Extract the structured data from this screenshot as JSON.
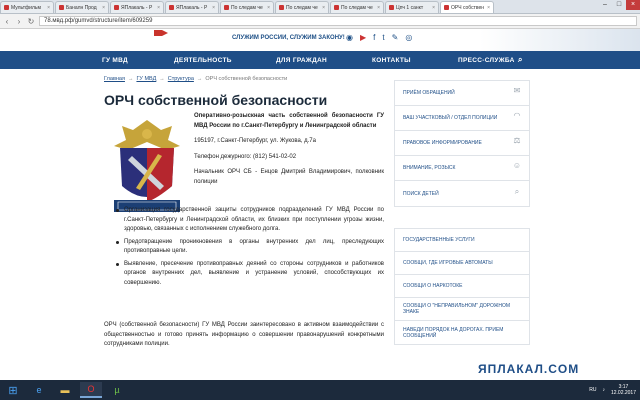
{
  "browser": {
    "tabs": [
      {
        "label": "Мультфильм"
      },
      {
        "label": "Баналн Прод"
      },
      {
        "label": "ЯПлакаль - Р"
      },
      {
        "label": "ЯПлакаль - Р"
      },
      {
        "label": "По следам че"
      },
      {
        "label": "По следам че"
      },
      {
        "label": "По следам че"
      },
      {
        "label": "Цпч 1 санкт"
      },
      {
        "label": "ОРЧ собствен"
      }
    ],
    "url": "78.мвд.рф/gumvd/structure/item/609259",
    "window_controls": {
      "minimize": "–",
      "maximize": "□",
      "close": "×"
    }
  },
  "site": {
    "slogan": "СЛУЖИМ РОССИИ, СЛУЖИМ ЗАКОНУ!",
    "social_icons": [
      "eye-icon",
      "youtube-icon",
      "facebook-icon",
      "twitter-icon",
      "vk-icon",
      "odnoklassniki-icon"
    ],
    "nav": [
      "ГУ МВД",
      "ДЕЯТЕЛЬНОСТЬ",
      "ДЛЯ ГРАЖДАН",
      "КОНТАКТЫ",
      "ПРЕСС-СЛУЖБА"
    ]
  },
  "breadcrumb": {
    "items": [
      "Главная",
      "ГУ МВД",
      "Структура"
    ],
    "current": "ОРЧ собственной безопасности",
    "sep": "→"
  },
  "page_title": "ОРЧ собственной безопасности",
  "info": {
    "org_name": "Оперативно-розыскная часть собственной безопасности ГУ МВД России по г.Санкт-Петербургу и Ленинградской области",
    "address": "195197, г.Санкт-Петербург, ул. Жукова, д.7а",
    "phone": "Телефон дежурного: (812) 541-02-02",
    "chief": "Начальник ОРЧ СБ - Енцов Дмитрий Владимирович, полковник полиции"
  },
  "duties": [
    "Организация государственной защиты сотрудников подразделений ГУ МВД России по г.Санкт-Петербургу и Ленинградской области, их близких при поступлении угрозы жизни, здоровью, связанных с исполнением служебного долга.",
    "Предотвращение проникновения в органы внутренних дел лиц, преследующих противоправные цели.",
    "Выявление, пресечение противоправных деяний со стороны сотрудников и работников органов внутренних дел, выявление и устранение условий, способствующих их совершению."
  ],
  "bottom_text": "ОРЧ (собственной безопасности) ГУ МВД России заинтересовано в активном взаимодействии с общественностью и готово принять информацию о совершении правонарушений конкретными сотрудниками полиции.",
  "sidebar": {
    "items": [
      {
        "label": "ПРИЁМ ОБРАЩЕНИЙ",
        "icon": "envelope-icon"
      },
      {
        "label": "ВАШ УЧАСТКОВЫЙ / ОТДЕЛ ПОЛИЦИИ",
        "icon": "police-cap-icon"
      },
      {
        "label": "ПРАВОВОЕ ИНФОРМИРОВАНИЕ",
        "icon": "scales-icon"
      },
      {
        "label": "ВНИМАНИЕ, РОЗЫСК",
        "icon": "wanted-icon"
      },
      {
        "label": "ПОИСК ДЕТЕЙ",
        "icon": "search-icon"
      }
    ],
    "secondary": [
      {
        "label": "ГОСУДАРСТВЕННЫЕ УСЛУГИ"
      },
      {
        "label": "СООБЩИ, ГДЕ ИГРОВЫЕ АВТОМАТЫ"
      },
      {
        "label": "СООБЩИ О НАРКОТОКЕ"
      },
      {
        "label": "СООБЩИ О \"НЕПРАВИЛЬНОМ\" ДОРОЖНОМ ЗНАКЕ"
      },
      {
        "label": "НАВЕДИ ПОРЯДОК НА ДОРОГАХ. ПРИЕМ СООБЩЕНИЙ"
      }
    ]
  },
  "watermark": "ЯПЛАКАЛ.COM",
  "taskbar": {
    "lang": "RU",
    "time": "3:17",
    "date": "12.02.2017"
  }
}
